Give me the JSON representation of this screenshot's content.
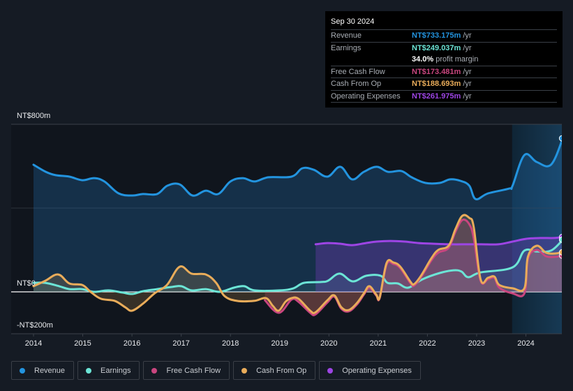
{
  "tooltip": {
    "date": "Sep 30 2024",
    "rows": [
      {
        "label": "Revenue",
        "value": "NT$733.175m",
        "unit": "/yr",
        "color": "#2394df"
      },
      {
        "label": "Earnings",
        "value": "NT$249.037m",
        "unit": "/yr",
        "color": "#6ce5d6"
      },
      {
        "label": "",
        "value": "34.0%",
        "unit": "profit margin",
        "color": "#ffffff"
      },
      {
        "label": "Free Cash Flow",
        "value": "NT$173.481m",
        "unit": "/yr",
        "color": "#c9467f"
      },
      {
        "label": "Cash From Op",
        "value": "NT$188.693m",
        "unit": "/yr",
        "color": "#e9ac5a"
      },
      {
        "label": "Operating Expenses",
        "value": "NT$261.975m",
        "unit": "/yr",
        "color": "#9d45e4"
      }
    ]
  },
  "legend": [
    {
      "label": "Revenue",
      "color": "#2394df"
    },
    {
      "label": "Earnings",
      "color": "#6ce5d6"
    },
    {
      "label": "Free Cash Flow",
      "color": "#c9467f"
    },
    {
      "label": "Cash From Op",
      "color": "#e9ac5a"
    },
    {
      "label": "Operating Expenses",
      "color": "#9d45e4"
    }
  ],
  "chart_data": {
    "type": "line",
    "title": "",
    "xlabel": "",
    "ylabel": "",
    "ylim": [
      -200,
      800
    ],
    "xlim": [
      2013.55,
      2024.75
    ],
    "y_tick_labels": [
      "NT$800m",
      "NT$0",
      "-NT$200m"
    ],
    "y_ticks": [
      800,
      400,
      0,
      -200
    ],
    "x_tick_labels": [
      "2014",
      "2015",
      "2016",
      "2017",
      "2018",
      "2019",
      "2020",
      "2021",
      "2022",
      "2023",
      "2024"
    ],
    "x_ticks": [
      2014,
      2015,
      2016,
      2017,
      2018,
      2019,
      2020,
      2021,
      2022,
      2023,
      2024
    ],
    "highlight_range": [
      2023.72,
      2024.75
    ],
    "units": "NT$ millions",
    "series": [
      {
        "name": "Revenue",
        "color": "#2394df",
        "x": [
          2014.0,
          2014.25,
          2014.45,
          2014.73,
          2014.99,
          2015.23,
          2015.44,
          2015.73,
          2016.01,
          2016.22,
          2016.51,
          2016.72,
          2016.97,
          2017.23,
          2017.5,
          2017.75,
          2018.0,
          2018.25,
          2018.49,
          2018.77,
          2019.24,
          2019.46,
          2019.69,
          2019.97,
          2020.23,
          2020.47,
          2020.71,
          2020.97,
          2021.2,
          2021.47,
          2021.68,
          2021.96,
          2022.25,
          2022.46,
          2022.67,
          2022.85,
          2022.98,
          2023.23,
          2023.66,
          2023.73,
          2023.97,
          2024.22,
          2024.51,
          2024.75
        ],
        "values": [
          607,
          573,
          557,
          550,
          533,
          543,
          527,
          470,
          460,
          467,
          467,
          507,
          513,
          460,
          483,
          467,
          527,
          543,
          527,
          547,
          550,
          590,
          583,
          550,
          597,
          537,
          573,
          597,
          573,
          577,
          547,
          520,
          520,
          537,
          530,
          507,
          443,
          470,
          493,
          507,
          653,
          620,
          607,
          733
        ]
      },
      {
        "name": "Earnings",
        "color": "#6ce5d6",
        "x": [
          2014.0,
          2014.24,
          2014.52,
          2014.73,
          2014.99,
          2015.23,
          2015.52,
          2015.8,
          2016.01,
          2016.22,
          2016.51,
          2016.79,
          2017.0,
          2017.21,
          2017.5,
          2017.78,
          2018.07,
          2018.28,
          2018.49,
          2019.0,
          2019.28,
          2019.49,
          2019.84,
          2019.98,
          2020.22,
          2020.48,
          2020.76,
          2021.05,
          2021.19,
          2021.4,
          2021.61,
          2021.9,
          2022.25,
          2022.53,
          2022.69,
          2022.83,
          2023.08,
          2023.73,
          2023.97,
          2024.22,
          2024.51,
          2024.75
        ],
        "values": [
          43,
          43,
          27,
          13,
          13,
          0,
          7,
          -3,
          -10,
          3,
          13,
          23,
          27,
          7,
          13,
          0,
          20,
          27,
          7,
          7,
          17,
          43,
          47,
          53,
          87,
          50,
          77,
          77,
          43,
          40,
          20,
          60,
          90,
          103,
          97,
          70,
          93,
          117,
          197,
          193,
          197,
          249
        ]
      },
      {
        "name": "Free Cash Flow",
        "color": "#c9467f",
        "x": [
          2018.7,
          2018.98,
          2019.24,
          2019.38,
          2019.62,
          2019.73,
          2019.97,
          2020.11,
          2020.25,
          2020.4,
          2020.57,
          2020.71,
          2020.82,
          2020.96,
          2021.03,
          2021.17,
          2021.31,
          2021.45,
          2021.66,
          2021.73,
          2021.87,
          2022.08,
          2022.22,
          2022.43,
          2022.57,
          2022.71,
          2022.85,
          2022.94,
          2023.08,
          2023.23,
          2023.36,
          2023.46,
          2023.73,
          2023.97,
          2024.04,
          2024.22,
          2024.41,
          2024.58,
          2024.75
        ],
        "values": [
          -40,
          -100,
          -37,
          -47,
          -100,
          -107,
          -50,
          -23,
          -80,
          -93,
          -60,
          -13,
          20,
          -17,
          -30,
          130,
          133,
          113,
          40,
          30,
          70,
          150,
          187,
          210,
          287,
          343,
          323,
          257,
          53,
          60,
          67,
          20,
          -7,
          -7,
          157,
          200,
          170,
          167,
          173
        ]
      },
      {
        "name": "Cash From Op",
        "color": "#e9ac5a",
        "x": [
          2014.0,
          2014.24,
          2014.5,
          2014.73,
          2014.99,
          2015.16,
          2015.37,
          2015.65,
          2015.86,
          2016.0,
          2016.22,
          2016.46,
          2016.71,
          2016.97,
          2017.21,
          2017.5,
          2017.71,
          2017.88,
          2018.13,
          2018.48,
          2018.72,
          2018.86,
          2018.98,
          2019.12,
          2019.24,
          2019.38,
          2019.62,
          2019.73,
          2019.97,
          2020.11,
          2020.25,
          2020.4,
          2020.57,
          2020.71,
          2020.82,
          2020.96,
          2021.03,
          2021.17,
          2021.31,
          2021.45,
          2021.66,
          2021.73,
          2021.87,
          2022.08,
          2022.22,
          2022.43,
          2022.57,
          2022.71,
          2022.85,
          2022.94,
          2023.08,
          2023.23,
          2023.36,
          2023.46,
          2023.73,
          2023.97,
          2024.04,
          2024.22,
          2024.41,
          2024.58,
          2024.75
        ],
        "values": [
          27,
          53,
          83,
          40,
          33,
          0,
          -33,
          -43,
          -73,
          -90,
          -57,
          -7,
          33,
          120,
          87,
          83,
          43,
          -20,
          -43,
          -43,
          -30,
          -67,
          -90,
          -47,
          -30,
          -33,
          -90,
          -97,
          -40,
          -17,
          -73,
          -87,
          -53,
          -7,
          27,
          -13,
          -27,
          137,
          140,
          120,
          47,
          37,
          77,
          160,
          200,
          220,
          300,
          363,
          353,
          310,
          60,
          67,
          73,
          33,
          17,
          17,
          167,
          220,
          187,
          183,
          189
        ]
      },
      {
        "name": "Operating Expenses",
        "color": "#9d45e4",
        "x": [
          2019.73,
          2019.97,
          2020.22,
          2020.47,
          2020.75,
          2020.97,
          2021.25,
          2021.54,
          2021.82,
          2022.1,
          2022.46,
          2022.82,
          2023.1,
          2023.44,
          2023.73,
          2024.0,
          2024.29,
          2024.57,
          2024.75
        ],
        "values": [
          227,
          233,
          230,
          223,
          233,
          240,
          243,
          240,
          233,
          230,
          227,
          227,
          227,
          227,
          240,
          253,
          257,
          257,
          262
        ]
      }
    ]
  }
}
